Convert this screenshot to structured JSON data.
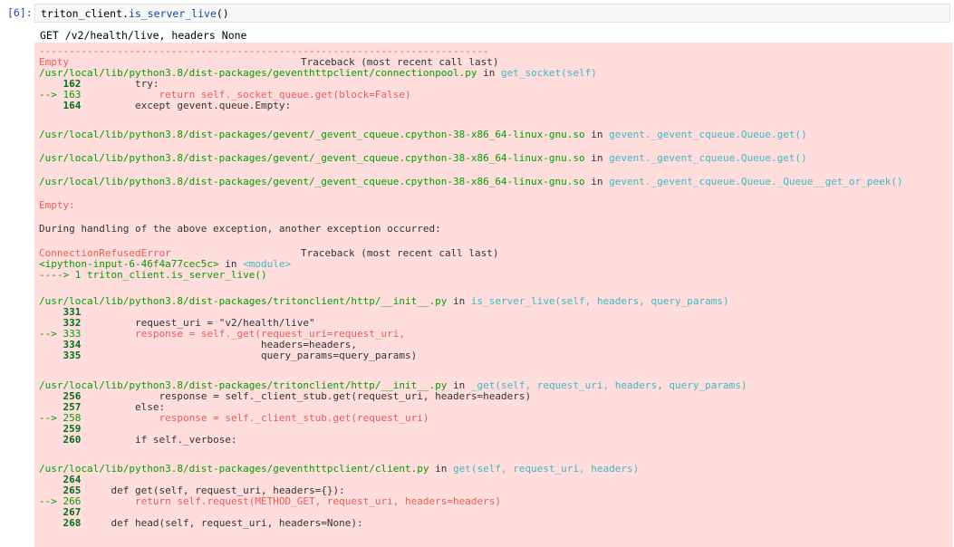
{
  "cell": {
    "prompt": "[6]:",
    "code_obj": "triton_client.",
    "code_method": "is_server_live",
    "code_tail": "()"
  },
  "stdout": "GET /v2/health/live, headers None",
  "traceback": {
    "rule": "---------------------------------------------------------------------------",
    "block1": {
      "exc": "Empty",
      "header": "Traceback (most recent call last)",
      "file": "/usr/local/lib/python3.8/dist-packages/geventhttpclient/connectionpool.py",
      "in": " in ",
      "func": "get_socket(self)",
      "lines": [
        {
          "arrow": "    ",
          "no": "162",
          "code": "        try:"
        },
        {
          "arrow": "--> ",
          "no": "163",
          "code": "            return self._socket_queue.get(block=False)"
        },
        {
          "arrow": "    ",
          "no": "164",
          "code": "        except gevent.queue.Empty:"
        }
      ]
    },
    "gevent_frames": [
      {
        "file": "/usr/local/lib/python3.8/dist-packages/gevent/_gevent_cqueue.cpython-38-x86_64-linux-gnu.so",
        "in": " in ",
        "func": "gevent._gevent_cqueue.Queue.get()"
      },
      {
        "file": "/usr/local/lib/python3.8/dist-packages/gevent/_gevent_cqueue.cpython-38-x86_64-linux-gnu.so",
        "in": " in ",
        "func": "gevent._gevent_cqueue.Queue.get()"
      },
      {
        "file": "/usr/local/lib/python3.8/dist-packages/gevent/_gevent_cqueue.cpython-38-x86_64-linux-gnu.so",
        "in": " in ",
        "func": "gevent._gevent_cqueue.Queue._Queue__get_or_peek()"
      }
    ],
    "empty_line": "Empty:",
    "during": "During handling of the above exception, another exception occurred:",
    "block2": {
      "exc": "ConnectionRefusedError",
      "header": "Traceback (most recent call last)",
      "input": "<ipython-input-6-46f4a77cec5c>",
      "in": " in ",
      "module": "<module>",
      "arrow_line": "----> 1 triton_client.is_server_live()"
    },
    "frame_live": {
      "file": "/usr/local/lib/python3.8/dist-packages/tritonclient/http/__init__.py",
      "in": " in ",
      "func": "is_server_live(self, headers, query_params)",
      "lines": [
        {
          "arrow": "    ",
          "no": "331",
          "code": ""
        },
        {
          "arrow": "    ",
          "no": "332",
          "code": "        request_uri = \"v2/health/live\""
        },
        {
          "arrow": "--> ",
          "no": "333",
          "code": "        response = self._get(request_uri=request_uri,"
        },
        {
          "arrow": "    ",
          "no": "334",
          "code": "                             headers=headers,"
        },
        {
          "arrow": "    ",
          "no": "335",
          "code": "                             query_params=query_params)"
        }
      ]
    },
    "frame_get": {
      "file": "/usr/local/lib/python3.8/dist-packages/tritonclient/http/__init__.py",
      "in": " in ",
      "func": "_get(self, request_uri, headers, query_params)",
      "lines": [
        {
          "arrow": "    ",
          "no": "256",
          "code": "            response = self._client_stub.get(request_uri, headers=headers)"
        },
        {
          "arrow": "    ",
          "no": "257",
          "code": "        else:"
        },
        {
          "arrow": "--> ",
          "no": "258",
          "code": "            response = self._client_stub.get(request_uri)"
        },
        {
          "arrow": "    ",
          "no": "259",
          "code": ""
        },
        {
          "arrow": "    ",
          "no": "260",
          "code": "        if self._verbose:"
        }
      ]
    },
    "frame_client": {
      "file": "/usr/local/lib/python3.8/dist-packages/geventhttpclient/client.py",
      "in": " in ",
      "func": "get(self, request_uri, headers)",
      "lines": [
        {
          "arrow": "    ",
          "no": "264",
          "code": ""
        },
        {
          "arrow": "    ",
          "no": "265",
          "code": "    def get(self, request_uri, headers={}):"
        },
        {
          "arrow": "--> ",
          "no": "266",
          "code": "        return self.request(METHOD_GET, request_uri, headers=headers)"
        },
        {
          "arrow": "    ",
          "no": "267",
          "code": ""
        },
        {
          "arrow": "    ",
          "no": "268",
          "code": "    def head(self, request_uri, headers=None):"
        }
      ]
    }
  }
}
